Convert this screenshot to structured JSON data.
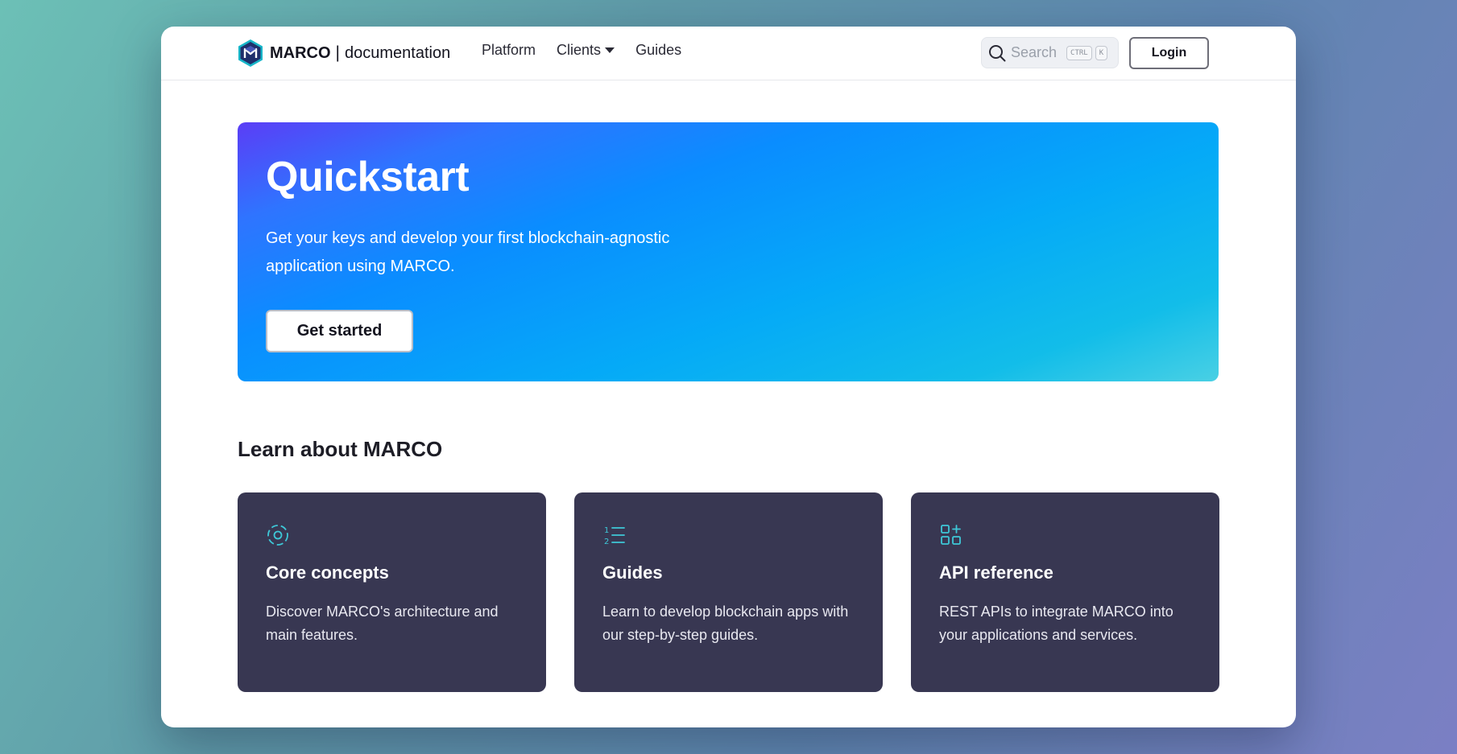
{
  "header": {
    "brand_name": "MARCO",
    "brand_separator": "|",
    "brand_suffix": "documentation",
    "nav": [
      {
        "label": "Platform"
      },
      {
        "label": "Clients",
        "has_dropdown": true
      },
      {
        "label": "Guides"
      }
    ],
    "search": {
      "placeholder": "Search",
      "shortcut_keys": [
        "CTRL",
        "K"
      ]
    },
    "login_label": "Login"
  },
  "hero": {
    "title": "Quickstart",
    "description": "Get your keys and develop your first blockchain-agnostic application using MARCO.",
    "button_label": "Get started"
  },
  "learn": {
    "title": "Learn about MARCO",
    "cards": [
      {
        "icon": "core-concepts-icon",
        "title": "Core concepts",
        "description": "Discover MARCO's architecture and main features."
      },
      {
        "icon": "numbered-list-icon",
        "title": "Guides",
        "description": "Learn to develop blockchain apps with our step-by-step guides."
      },
      {
        "icon": "grid-add-icon",
        "title": "API reference",
        "description": "REST APIs to integrate MARCO into your applications and services."
      }
    ]
  },
  "colors": {
    "card_bg": "#383752",
    "icon_accent": "#3ec8d8",
    "hero_gradient_start": "#5b3df6",
    "hero_gradient_end": "#49d0e4"
  }
}
